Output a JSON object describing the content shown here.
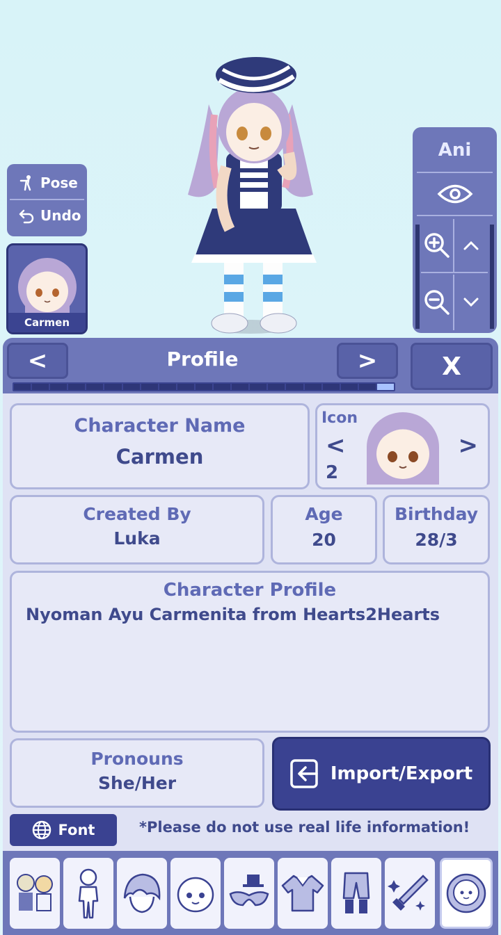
{
  "left_controls": {
    "pose_label": "Pose",
    "undo_label": "Undo",
    "character_name": "Carmen"
  },
  "camera": {
    "ani_label": "Ani"
  },
  "header": {
    "title": "Profile",
    "prev_label": "<",
    "next_label": ">",
    "close_label": "X",
    "progress_segments": 21,
    "progress_current": 21
  },
  "profile": {
    "character_name_label": "Character Name",
    "character_name_value": "Carmen",
    "icon_label": "Icon",
    "icon_prev": "<",
    "icon_next": ">",
    "icon_number": "2",
    "created_by_label": "Created By",
    "created_by_value": "Luka",
    "age_label": "Age",
    "age_value": "20",
    "birthday_label": "Birthday",
    "birthday_value": "28/3",
    "character_profile_label": "Character Profile",
    "character_profile_value": "Nyoman Ayu Carmenita from Hearts2Hearts",
    "pronouns_label": "Pronouns",
    "pronouns_value": "She/Her"
  },
  "actions": {
    "import_export_label": "Import/Export",
    "font_label": "Font",
    "note": "*Please do not use real life information!"
  },
  "tabs": [
    {
      "icon": "presets-icon"
    },
    {
      "icon": "body-icon"
    },
    {
      "icon": "hair-icon"
    },
    {
      "icon": "face-icon"
    },
    {
      "icon": "accessories-icon"
    },
    {
      "icon": "top-icon"
    },
    {
      "icon": "bottom-icon"
    },
    {
      "icon": "props-icon"
    },
    {
      "icon": "profile-icon",
      "selected": true
    }
  ],
  "colors": {
    "panel_bg": "#dfe2f4",
    "header_bg": "#6e77b9",
    "accent_dark": "#3a4291",
    "label_text": "#5f6ab5",
    "value_text": "#3f4a8c"
  }
}
